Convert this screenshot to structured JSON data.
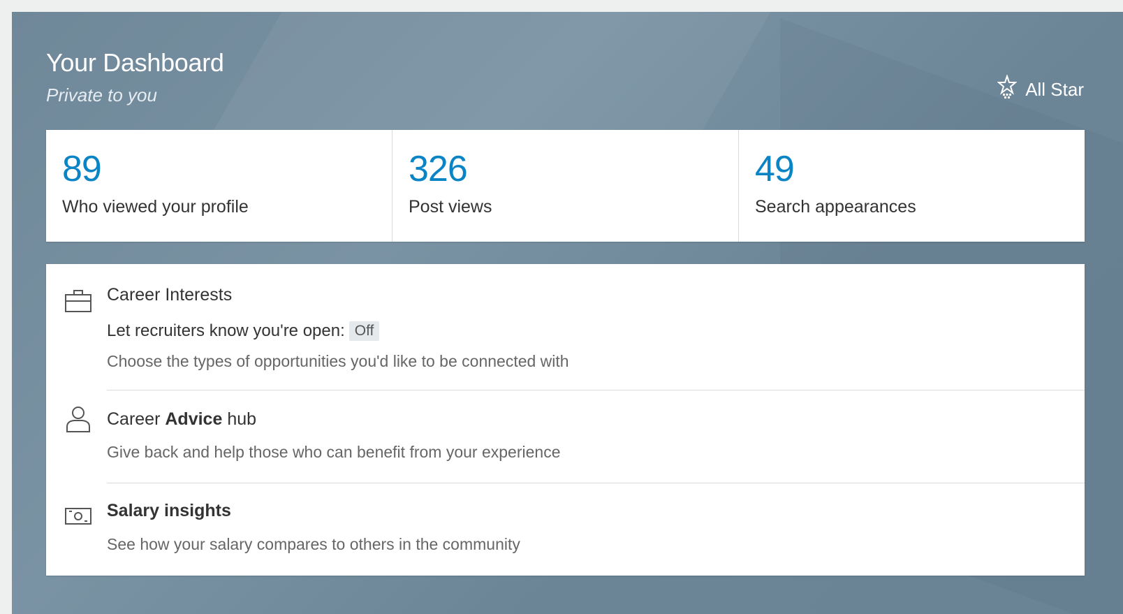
{
  "header": {
    "title": "Your Dashboard",
    "subtitle": "Private to you",
    "badge_label": "All Star",
    "badge_icon": "all-star-icon"
  },
  "stats": [
    {
      "value": "89",
      "label": "Who viewed your profile"
    },
    {
      "value": "326",
      "label": "Post views"
    },
    {
      "value": "49",
      "label": "Search appearances"
    }
  ],
  "items": {
    "career_interests": {
      "icon": "briefcase-icon",
      "title": "Career Interests",
      "toggle_label": "Let recruiters know you're open:",
      "toggle_value": "Off",
      "description": "Choose the types of opportunities you'd like to be connected with"
    },
    "career_advice": {
      "icon": "person-icon",
      "title_prefix": "Career",
      "title_bold": "Advice",
      "title_suffix": "hub",
      "description": "Give back and help those who can benefit from your experience"
    },
    "salary": {
      "icon": "money-icon",
      "title": "Salary insights",
      "description": "See how your salary compares to others in the community"
    }
  },
  "colors": {
    "accent": "#0a84c4",
    "header_bg": "#6f8899"
  }
}
